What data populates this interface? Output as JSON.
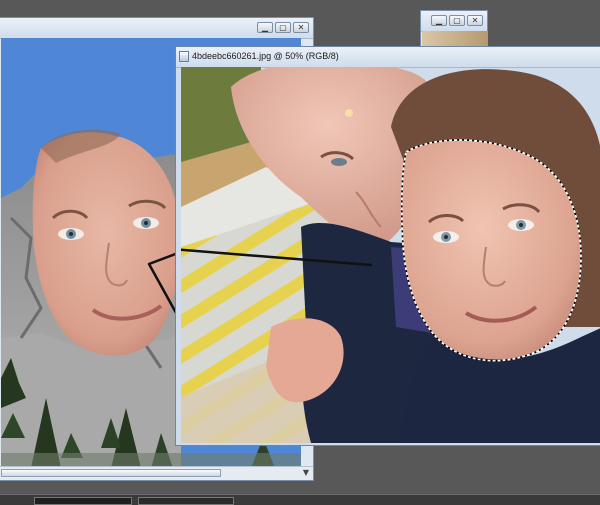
{
  "app": {
    "front_window": {
      "title": "4bdeebc660261.jpg @ 50% (RGB/8)"
    },
    "back_window": {
      "title": ""
    },
    "window_buttons": {
      "minimize": "▁",
      "maximize": "▢",
      "close": "✕"
    },
    "scroll_arrow": "▼"
  },
  "colors": {
    "workspace": "#585858",
    "sky": "#4f86d6",
    "titlebar": "#dbe6f2",
    "selection": "#ffffff"
  },
  "icons": [
    "document-icon",
    "minimize-icon",
    "maximize-icon",
    "close-icon",
    "scroll-down-icon"
  ]
}
